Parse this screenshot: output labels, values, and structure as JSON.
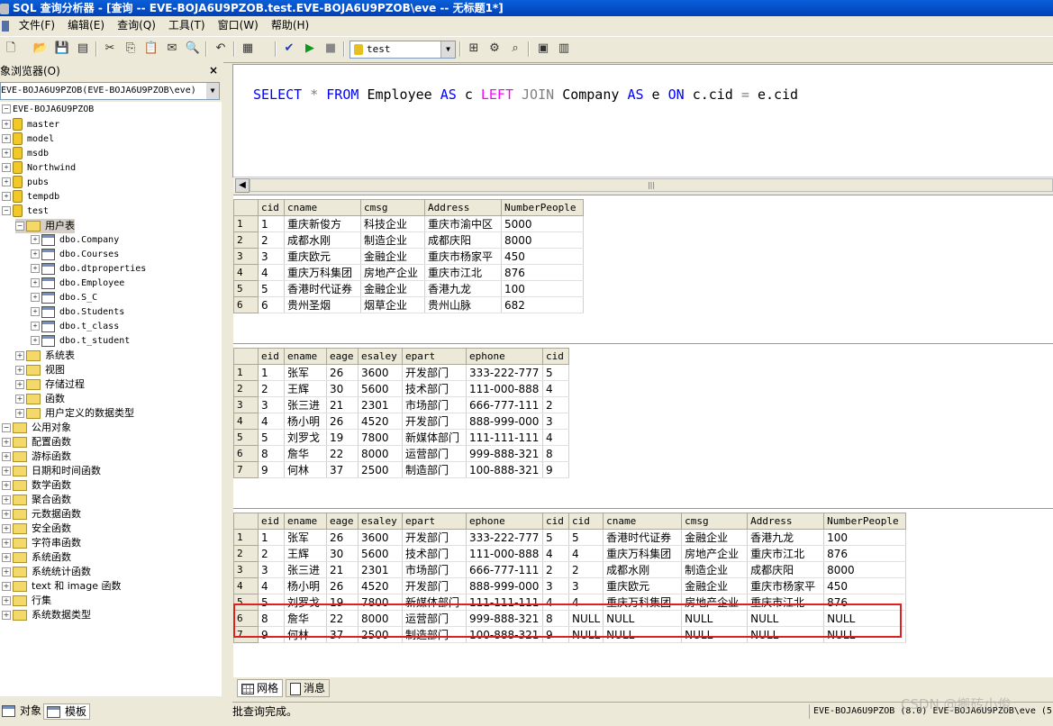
{
  "window": {
    "title": "SQL 查询分析器 - [查询 -- EVE-BOJA6U9PZOB.test.EVE-BOJA6U9PZOB\\eve -- 无标题1*]"
  },
  "menu": [
    "文件(F)",
    "编辑(E)",
    "查询(Q)",
    "工具(T)",
    "窗口(W)",
    "帮助(H)"
  ],
  "toolbar": {
    "database": "test"
  },
  "object_browser": {
    "title": "象浏览器(O)",
    "close": "×",
    "server_combo": "EVE-BOJA6U9PZOB(EVE-BOJA6U9PZOB\\eve)",
    "server": "EVE-BOJA6U9PZOB",
    "databases": [
      "master",
      "model",
      "msdb",
      "Northwind",
      "pubs",
      "tempdb",
      "test"
    ],
    "user_tables_folder": "用户表",
    "tables": [
      "dbo.Company",
      "dbo.Courses",
      "dbo.dtproperties",
      "dbo.Employee",
      "dbo.S_C",
      "dbo.Students",
      "dbo.t_class",
      "dbo.t_student"
    ],
    "db_folders": [
      "系统表",
      "视图",
      "存储过程",
      "函数",
      "用户定义的数据类型"
    ],
    "public_objects": "公用对象",
    "public_folders": [
      "配置函数",
      "游标函数",
      "日期和时间函数",
      "数学函数",
      "聚合函数",
      "元数据函数",
      "安全函数",
      "字符串函数",
      "系统函数",
      "系统统计函数",
      "text 和 image 函数",
      "行集",
      "系统数据类型"
    ],
    "tabs": [
      "对象",
      "模板"
    ]
  },
  "editor": {
    "sql": {
      "t1": "SELECT",
      "t2": "*",
      "t3": "FROM",
      "t4": "Employee",
      "t5": "AS",
      "t6": "c",
      "t7": "LEFT",
      "t8": "JOIN",
      "t9": "Company",
      "t10": "AS",
      "t11": "e",
      "t12": "ON",
      "t13": "c.cid",
      "t14": "=",
      "t15": "e.cid"
    }
  },
  "results": {
    "company": {
      "columns": [
        "cid",
        "cname",
        "cmsg",
        "Address",
        "NumberPeople"
      ],
      "rows": [
        [
          "1",
          "1",
          "重庆新俊方",
          "科技企业",
          "重庆市渝中区",
          "5000"
        ],
        [
          "2",
          "2",
          "成都水刚",
          "制造企业",
          "成都庆阳",
          "8000"
        ],
        [
          "3",
          "3",
          "重庆欧元",
          "金融企业",
          "重庆市杨家平",
          "450"
        ],
        [
          "4",
          "4",
          "重庆万科集团",
          "房地产企业",
          "重庆市江北",
          "876"
        ],
        [
          "5",
          "5",
          "香港时代证券",
          "金融企业",
          "香港九龙",
          "100"
        ],
        [
          "6",
          "6",
          "贵州圣烟",
          "烟草企业",
          "贵州山脉",
          "682"
        ]
      ]
    },
    "employee": {
      "columns": [
        "eid",
        "ename",
        "eage",
        "esaley",
        "epart",
        "ephone",
        "cid"
      ],
      "rows": [
        [
          "1",
          "1",
          "张军",
          "26",
          "3600",
          "开发部门",
          "333-222-777",
          "5"
        ],
        [
          "2",
          "2",
          "王辉",
          "30",
          "5600",
          "技术部门",
          "111-000-888",
          "4"
        ],
        [
          "3",
          "3",
          "张三进",
          "21",
          "2301",
          "市场部门",
          "666-777-111",
          "2"
        ],
        [
          "4",
          "4",
          "杨小明",
          "26",
          "4520",
          "开发部门",
          "888-999-000",
          "3"
        ],
        [
          "5",
          "5",
          "刘罗戈",
          "19",
          "7800",
          "新媒体部门",
          "111-111-111",
          "4"
        ],
        [
          "6",
          "8",
          "詹华",
          "22",
          "8000",
          "运营部门",
          "999-888-321",
          "8"
        ],
        [
          "7",
          "9",
          "何林",
          "37",
          "2500",
          "制造部门",
          "100-888-321",
          "9"
        ]
      ]
    },
    "joined": {
      "columns": [
        "eid",
        "ename",
        "eage",
        "esaley",
        "epart",
        "ephone",
        "cid",
        "cid",
        "cname",
        "cmsg",
        "Address",
        "NumberPeople"
      ],
      "rows": [
        [
          "1",
          "1",
          "张军",
          "26",
          "3600",
          "开发部门",
          "333-222-777",
          "5",
          "5",
          "香港时代证券",
          "金融企业",
          "香港九龙",
          "100"
        ],
        [
          "2",
          "2",
          "王辉",
          "30",
          "5600",
          "技术部门",
          "111-000-888",
          "4",
          "4",
          "重庆万科集团",
          "房地产企业",
          "重庆市江北",
          "876"
        ],
        [
          "3",
          "3",
          "张三进",
          "21",
          "2301",
          "市场部门",
          "666-777-111",
          "2",
          "2",
          "成都水刚",
          "制造企业",
          "成都庆阳",
          "8000"
        ],
        [
          "4",
          "4",
          "杨小明",
          "26",
          "4520",
          "开发部门",
          "888-999-000",
          "3",
          "3",
          "重庆欧元",
          "金融企业",
          "重庆市杨家平",
          "450"
        ],
        [
          "5",
          "5",
          "刘罗戈",
          "19",
          "7800",
          "新媒体部门",
          "111-111-111",
          "4",
          "4",
          "重庆万科集团",
          "房地产企业",
          "重庆市江北",
          "876"
        ],
        [
          "6",
          "8",
          "詹华",
          "22",
          "8000",
          "运营部门",
          "999-888-321",
          "8",
          "NULL",
          "NULL",
          "NULL",
          "NULL",
          "NULL"
        ],
        [
          "7",
          "9",
          "何林",
          "37",
          "2500",
          "制造部门",
          "100-888-321",
          "9",
          "NULL",
          "NULL",
          "NULL",
          "NULL",
          "NULL"
        ]
      ]
    }
  },
  "bottom_tabs": [
    "网格",
    "消息"
  ],
  "status": {
    "message": "批查询完成。",
    "connection": "EVE-BOJA6U9PZOB (8.0) EVE-BOJA6U9PZOB\\eve (5"
  },
  "watermark": "CSDN @搬砖小俊"
}
